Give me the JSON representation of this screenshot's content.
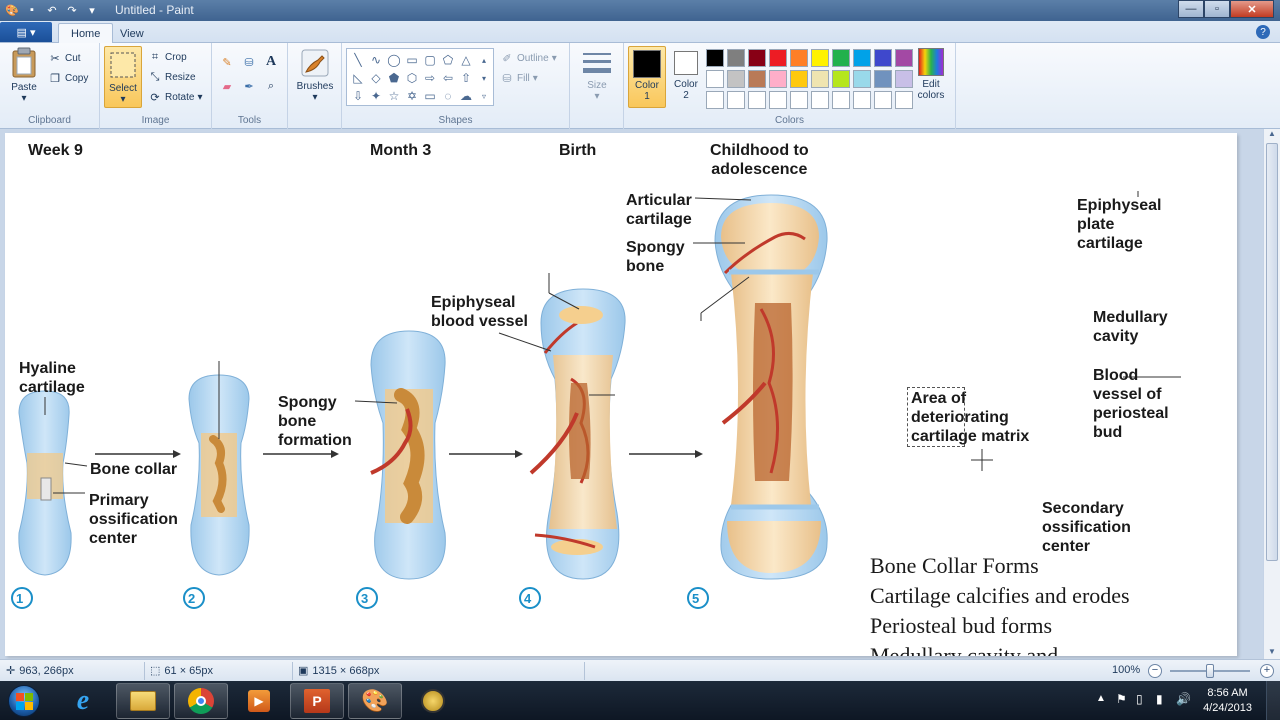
{
  "window": {
    "title": "Untitled - Paint"
  },
  "ribbon": {
    "tabs": [
      {
        "label": "Home",
        "active": true
      },
      {
        "label": "View",
        "active": false
      }
    ],
    "clipboard": {
      "group_label": "Clipboard",
      "paste": "Paste",
      "cut": "Cut",
      "copy": "Copy"
    },
    "image": {
      "group_label": "Image",
      "select": "Select",
      "crop": "Crop",
      "resize": "Resize",
      "rotate": "Rotate"
    },
    "tools": {
      "group_label": "Tools"
    },
    "brushes": {
      "label": "Brushes"
    },
    "shapes": {
      "group_label": "Shapes",
      "outline": "Outline",
      "fill": "Fill"
    },
    "size": {
      "label": "Size"
    },
    "colors": {
      "group_label": "Colors",
      "color1_line1": "Color",
      "color1_line2": "1",
      "color2_line1": "Color",
      "color2_line2": "2",
      "edit_line1": "Edit",
      "edit_line2": "colors",
      "color1": "#000000",
      "color2": "#ffffff",
      "palette": [
        "#000000",
        "#7f7f7f",
        "#880015",
        "#ed1c24",
        "#ff7f27",
        "#fff200",
        "#22b14c",
        "#00a2e8",
        "#3f48cc",
        "#a349a4",
        "#ffffff",
        "#c3c3c3",
        "#b97a57",
        "#ffaec9",
        "#ffc90e",
        "#efe4b0",
        "#b5e61d",
        "#99d9ea",
        "#7092be",
        "#c8bfe7",
        "#ffffff",
        "#ffffff",
        "#ffffff",
        "#ffffff",
        "#ffffff",
        "#ffffff",
        "#ffffff",
        "#ffffff",
        "#ffffff",
        "#ffffff"
      ]
    }
  },
  "canvas": {
    "stage_titles": {
      "week9": "Week 9",
      "month3": "Month 3",
      "birth": "Birth",
      "childhood": "Childhood to\nadolescence"
    },
    "labels": {
      "hyaline": "Hyaline\ncartilage",
      "bone_collar": "Bone collar",
      "primary": "Primary\nossification\ncenter",
      "spongy_formation": "Spongy\nbone\nformation",
      "epiphyseal_vessel": "Epiphyseal\nblood vessel",
      "articular": "Articular\ncartilage",
      "spongy_bone": "Spongy\nbone",
      "epiphyseal_plate": "Epiphyseal\nplate\ncartilage",
      "medullary": "Medullary\ncavity",
      "blood_vessel_periosteal": "Blood\nvessel of\nperiosteal\nbud",
      "area_deteriorating": "Area of\ndeteriorating\ncartilage matrix",
      "secondary": "Secondary\nossification\ncenter"
    },
    "step_numbers": [
      "1",
      "2",
      "3",
      "4",
      "5"
    ],
    "notes": [
      "Bone Collar Forms",
      "Cartilage calcifies and erodes",
      "Periosteal bud forms",
      "Medullary cavity and"
    ]
  },
  "statusbar": {
    "cursor_pos": "963, 266px",
    "selection_size": "61 × 65px",
    "image_size": "1315 × 668px",
    "zoom": "100%",
    "zoom_level": 0.5
  },
  "taskbar": {
    "time": "8:56 AM",
    "date": "4/24/2013"
  }
}
